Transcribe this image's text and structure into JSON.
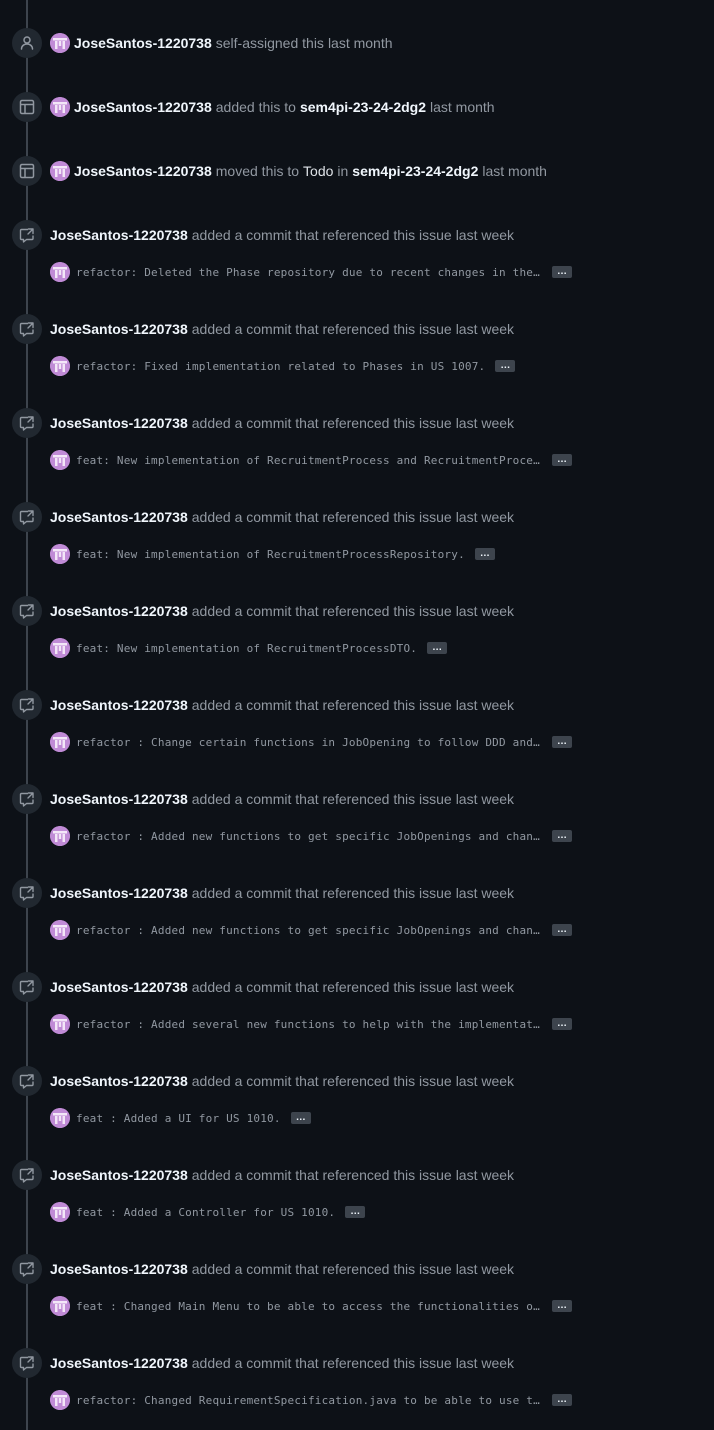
{
  "user": "JoseSantos-1220738",
  "simple_events": [
    {
      "icon": "person-icon",
      "parts": [
        {
          "t": "self-assigned this",
          "k": "muted"
        },
        {
          "t": "last month",
          "k": "muted"
        }
      ]
    },
    {
      "icon": "project-table-icon",
      "parts": [
        {
          "t": "added this to",
          "k": "muted"
        },
        {
          "t": "sem4pi-23-24-2dg2",
          "k": "strong"
        },
        {
          "t": "last month",
          "k": "muted"
        }
      ]
    },
    {
      "icon": "project-table-icon",
      "parts": [
        {
          "t": "moved this to",
          "k": "muted"
        },
        {
          "t": "Todo",
          "k": "plain"
        },
        {
          "t": "in",
          "k": "muted"
        },
        {
          "t": "sem4pi-23-24-2dg2",
          "k": "strong"
        },
        {
          "t": "last month",
          "k": "muted"
        }
      ]
    }
  ],
  "commit_event_text": "added a commit that referenced this issue",
  "commit_event_time": "last week",
  "expander_label": "…",
  "commits": [
    "refactor: Deleted the Phase repository due to recent changes in the P…",
    "refactor: Fixed implementation related to Phases in US 1007.",
    "feat: New implementation of RecruitmentProcess and RecruitmentProcess…",
    "feat: New implementation of RecruitmentProcessRepository.",
    "feat: New implementation of RecruitmentProcessDTO.",
    "refactor : Change certain functions in JobOpening to follow DDD and g…",
    "refactor : Added new functions to get specific JobOpenings and change…",
    "refactor : Added new functions to get specific JobOpenings and change…",
    "refactor : Added several new functions to help with the implementatio…",
    "feat : Added a UI for US 1010.",
    "feat : Added a Controller for US 1010.",
    "feat : Changed Main Menu to be able to access the functionalities of …",
    "refactor: Changed RequirementSpecification.java to be able to use the…"
  ],
  "colors": {
    "background": "#0d1117",
    "text_strong": "#f0f6fc",
    "text_muted": "#9198a1",
    "badge_bg": "#212830",
    "avatar": "#c08bd6"
  }
}
